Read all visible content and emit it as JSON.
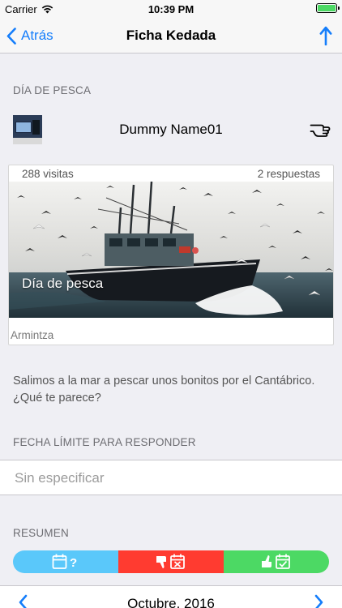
{
  "status_bar": {
    "carrier": "Carrier",
    "time": "10:39 PM"
  },
  "nav": {
    "back_label": "Atrás",
    "title": "Ficha Kedada",
    "back_icon": "chevron-left-icon",
    "action_icon": "arrow-up-icon"
  },
  "event": {
    "section_header": "DÍA DE PESCA",
    "author_name": "Dummy Name01",
    "visits": "288 visitas",
    "replies": "2 respuestas",
    "title": "Día de pesca",
    "location": "Armintza",
    "description": "Salimos a la mar a pescar unos bonitos por el Cantábrico. ¿Qué te parece?"
  },
  "deadline": {
    "section_header": "FECHA LÍMITE PARA RESPONDER",
    "value": "Sin especificar"
  },
  "summary": {
    "section_header": "RESUMEN",
    "segments": [
      {
        "icon": "calendar-question-icon",
        "color": "#5ac8fa"
      },
      {
        "icon": "thumbs-down-calendar-icon",
        "color": "#ff3b30"
      },
      {
        "icon": "thumbs-up-calendar-icon",
        "color": "#4cd964"
      }
    ]
  },
  "calendar": {
    "month_label": "Octubre, 2016"
  },
  "colors": {
    "accent": "#157efb",
    "background": "#efeff4"
  }
}
